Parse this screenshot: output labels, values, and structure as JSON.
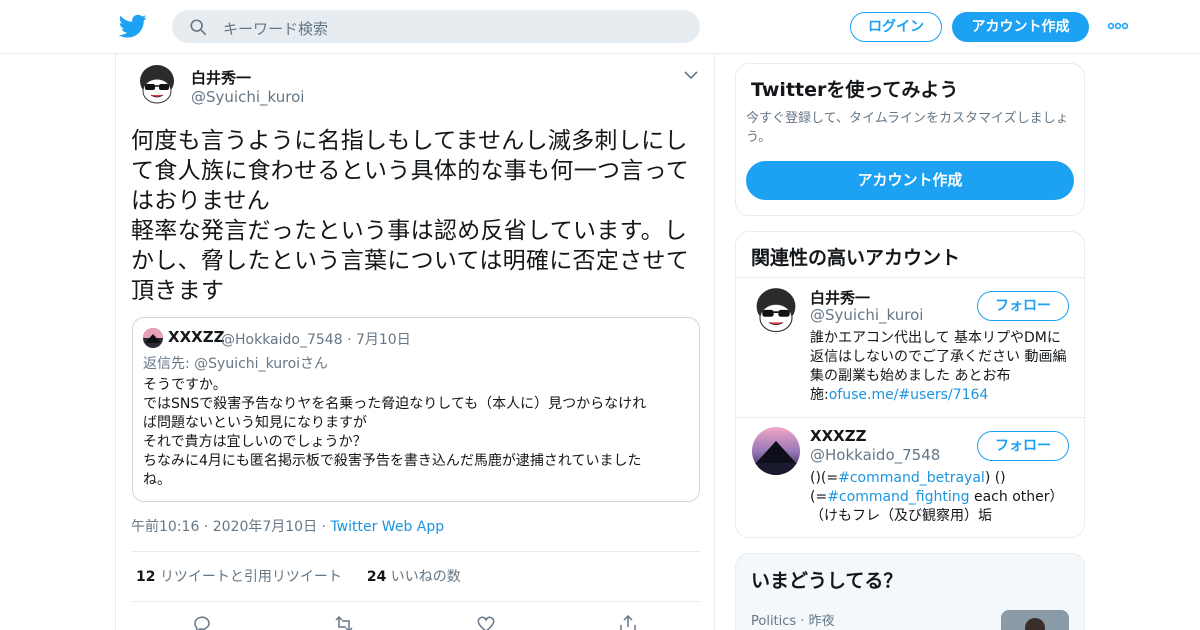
{
  "header": {
    "search_placeholder": "キーワード検索",
    "login_label": "ログイン",
    "signup_label": "アカウント作成",
    "brand_color": "#1da1f2"
  },
  "tweet": {
    "author_name": "白井秀一",
    "author_handle": "@Syuichi_kuroi",
    "text": "何度も言うように名指しもしてませんし滅多刺しにし\nて食人族に食わせるという具体的な事も何一つ言って\nはおりません\n軽率な発言だったという事は認め反省しています。し\nかし、脅したという言葉については明確に否定させて\n頂きます",
    "quote": {
      "author_name": "XXXZZ",
      "author_handle": "@Hokkaido_7548",
      "date": "7月10日",
      "reply_prefix": "返信先: ",
      "reply_to": "@Syuichi_kuroi",
      "reply_suffix": "さん",
      "text": "そうですか。\nではSNSで殺害予告なりヤを名乗った脅迫なりしても（本人に）見つからなけれ\nば問題ないという知見になりますが\nそれで貴方は宜しいのでしょうか？\nちなみに4月にも匿名掲示板で殺害予告を書き込んだ馬鹿が逮捕されていました\nね。"
    },
    "time": "午前10:16",
    "date": "2020年7月10日",
    "app": "Twitter Web App",
    "retweets_count": "12",
    "retweets_label": "リツイートと引用リツイート",
    "likes_count": "24",
    "likes_label": "いいねの数"
  },
  "sidebar": {
    "signup_card": {
      "title": "Twitterを使ってみよう",
      "description": "今すぐ登録して、タイムラインをカスタマイズしましょう。",
      "button_label": "アカウント作成"
    },
    "related": {
      "title": "関連性の高いアカウント",
      "accounts": [
        {
          "name": "白井秀一",
          "handle": "@Syuichi_kuroi",
          "follow_label": "フォロー",
          "bio_text": "誰かエアコン代出して 基本リプやDMに返信はしないのでご了承ください 動画編集の副業も始めました あとお布施:",
          "bio_link": "ofuse.me/#users/7164"
        },
        {
          "name": "XXXZZ",
          "handle": "@Hokkaido_7548",
          "follow_label": "フォロー",
          "bio_pre": "()(=",
          "bio_tag1": "#command_betrayal",
          "bio_mid": ") ()\n(=",
          "bio_tag2": "#command_fighting",
          "bio_post": " each other）（けもフレ（及び観察用）垢"
        }
      ]
    },
    "trends": {
      "title": "いまどうしてる？",
      "category": "Politics",
      "time": "昨夜"
    }
  }
}
